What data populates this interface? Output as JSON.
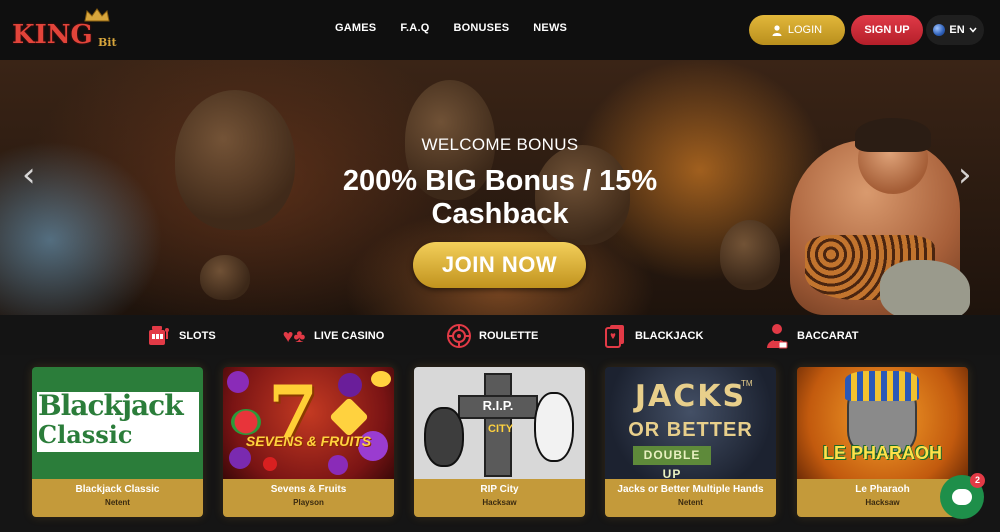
{
  "brand": {
    "logo_main": "KING",
    "logo_sub": "Bit"
  },
  "nav": [
    {
      "label": "GAMES"
    },
    {
      "label": "F.A.Q"
    },
    {
      "label": "BONUSES"
    },
    {
      "label": "NEWS"
    }
  ],
  "header": {
    "login_label": "LOGIN",
    "signup_label": "SIGN UP",
    "language": "EN"
  },
  "hero": {
    "subtitle": "WELCOME BONUS",
    "title": "200% BIG Bonus / 15% Cashback",
    "cta": "JOIN NOW"
  },
  "categories": [
    {
      "label": "SLOTS",
      "icon": "slot-machine-icon"
    },
    {
      "label": "LIVE CASINO",
      "icon": "card-suits-icon"
    },
    {
      "label": "ROULETTE",
      "icon": "roulette-icon"
    },
    {
      "label": "BLACKJACK",
      "icon": "playing-cards-icon"
    },
    {
      "label": "BACCARAT",
      "icon": "dealer-icon"
    }
  ],
  "games": [
    {
      "name": "Blackjack Classic",
      "provider": "Netent",
      "thumb_text": [
        "Blackjack",
        "Classic"
      ]
    },
    {
      "name": "Sevens & Fruits",
      "provider": "Playson",
      "thumb_text": [
        "7",
        "SEVENS & FRUITS"
      ]
    },
    {
      "name": "RIP City",
      "provider": "Hacksaw",
      "thumb_text": [
        "R.I.P.",
        "CITY"
      ]
    },
    {
      "name": "Jacks or Better Multiple Hands",
      "provider": "Netent",
      "thumb_text": [
        "JACKS",
        "OR BETTER",
        "DOUBLE UP",
        "TM"
      ]
    },
    {
      "name": "Le Pharaoh",
      "provider": "Hacksaw",
      "thumb_text": [
        "LE PHARAOH"
      ]
    }
  ],
  "chat": {
    "badge_count": "2"
  },
  "colors": {
    "gold": "#c49a3a",
    "red": "#e03a47",
    "background": "#111111"
  }
}
